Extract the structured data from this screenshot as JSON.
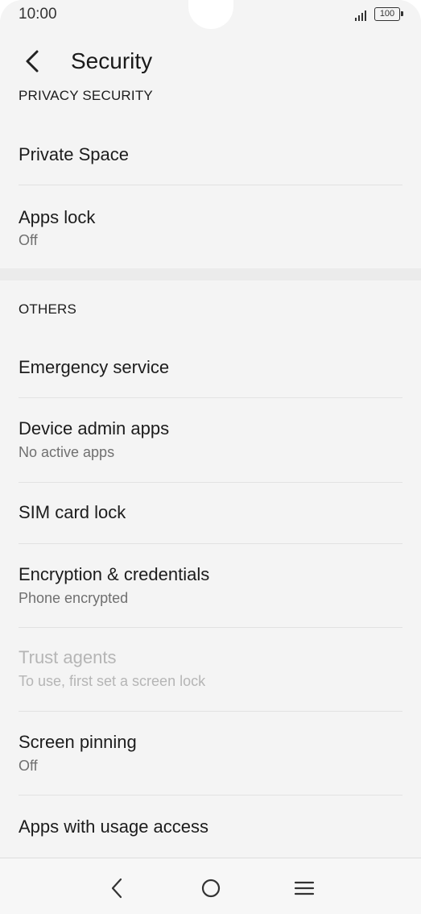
{
  "status_bar": {
    "time": "10:00",
    "battery": "100",
    "icons": [
      "signal-icon",
      "battery-icon"
    ]
  },
  "app_bar": {
    "title": "Security",
    "back_icon": "chevron-left-icon"
  },
  "sections": {
    "privacy": {
      "header": "PRIVACY SECURITY",
      "items": [
        {
          "title": "Private Space"
        },
        {
          "title": "Apps lock",
          "subtitle": "Off"
        }
      ]
    },
    "others": {
      "header": "OTHERS",
      "items": [
        {
          "title": "Emergency service"
        },
        {
          "title": "Device admin apps",
          "subtitle": "No active apps"
        },
        {
          "title": "SIM card lock"
        },
        {
          "title": "Encryption & credentials",
          "subtitle": "Phone encrypted"
        },
        {
          "title": "Trust agents",
          "subtitle": "To use, first set a screen lock",
          "disabled": true
        },
        {
          "title": "Screen pinning",
          "subtitle": "Off"
        },
        {
          "title": "Apps with usage access"
        }
      ]
    }
  },
  "nav_bar": {
    "icons": [
      "back-nav-icon",
      "home-nav-icon",
      "menu-nav-icon"
    ]
  },
  "colors": {
    "background": "#f4f4f4",
    "text_primary": "#1c1c1c",
    "text_secondary": "#707070",
    "text_disabled": "#b5b5b5",
    "divider": "#e2e2e2"
  }
}
